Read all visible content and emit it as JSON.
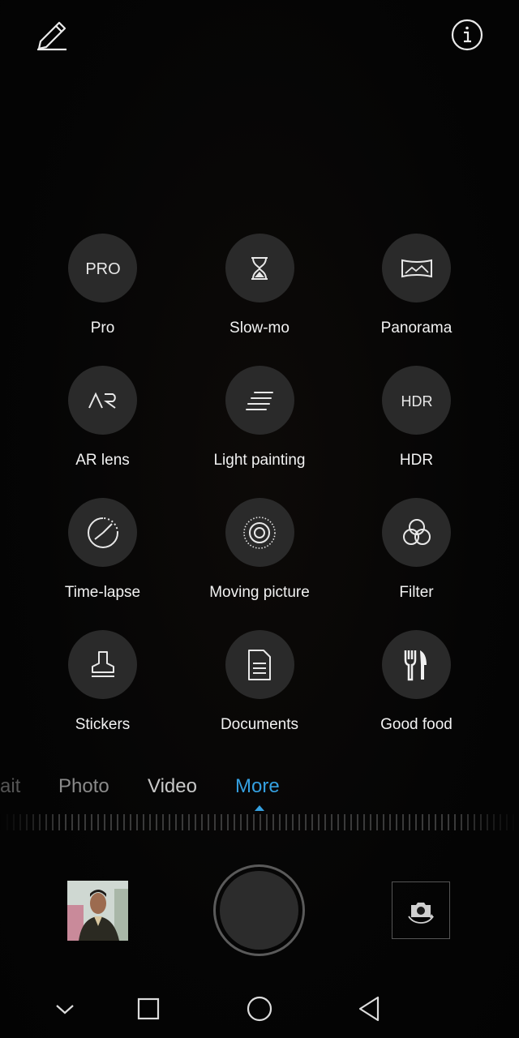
{
  "top_bar": {
    "edit_icon": "pencil-icon",
    "info_icon": "info-icon"
  },
  "modes": [
    {
      "label": "Pro",
      "icon": "pro-icon",
      "icon_text": "PRO"
    },
    {
      "label": "Slow-mo",
      "icon": "hourglass-icon"
    },
    {
      "label": "Panorama",
      "icon": "panorama-icon"
    },
    {
      "label": "AR lens",
      "icon": "ar-icon",
      "icon_text": "AR"
    },
    {
      "label": "Light painting",
      "icon": "light-streak-icon"
    },
    {
      "label": "HDR",
      "icon": "hdr-icon",
      "icon_text": "HDR"
    },
    {
      "label": "Time-lapse",
      "icon": "timelapse-icon"
    },
    {
      "label": "Moving picture",
      "icon": "moving-picture-icon"
    },
    {
      "label": "Filter",
      "icon": "filter-icon"
    },
    {
      "label": "Stickers",
      "icon": "stamp-icon"
    },
    {
      "label": "Documents",
      "icon": "document-icon"
    },
    {
      "label": "Good food",
      "icon": "fork-knife-icon"
    }
  ],
  "tabs": {
    "partial": "ait",
    "photo": "Photo",
    "video": "Video",
    "more": "More",
    "active": "More"
  },
  "colors": {
    "accent": "#35a0e0",
    "circle": "#2a2a2a",
    "background": "#050505"
  },
  "bottom_controls": {
    "gallery_icon": "gallery-thumbnail",
    "shutter_icon": "shutter-button",
    "switch_icon": "switch-camera-icon"
  },
  "nav": [
    "chevron-down-icon",
    "recents-icon",
    "home-icon",
    "back-icon"
  ]
}
